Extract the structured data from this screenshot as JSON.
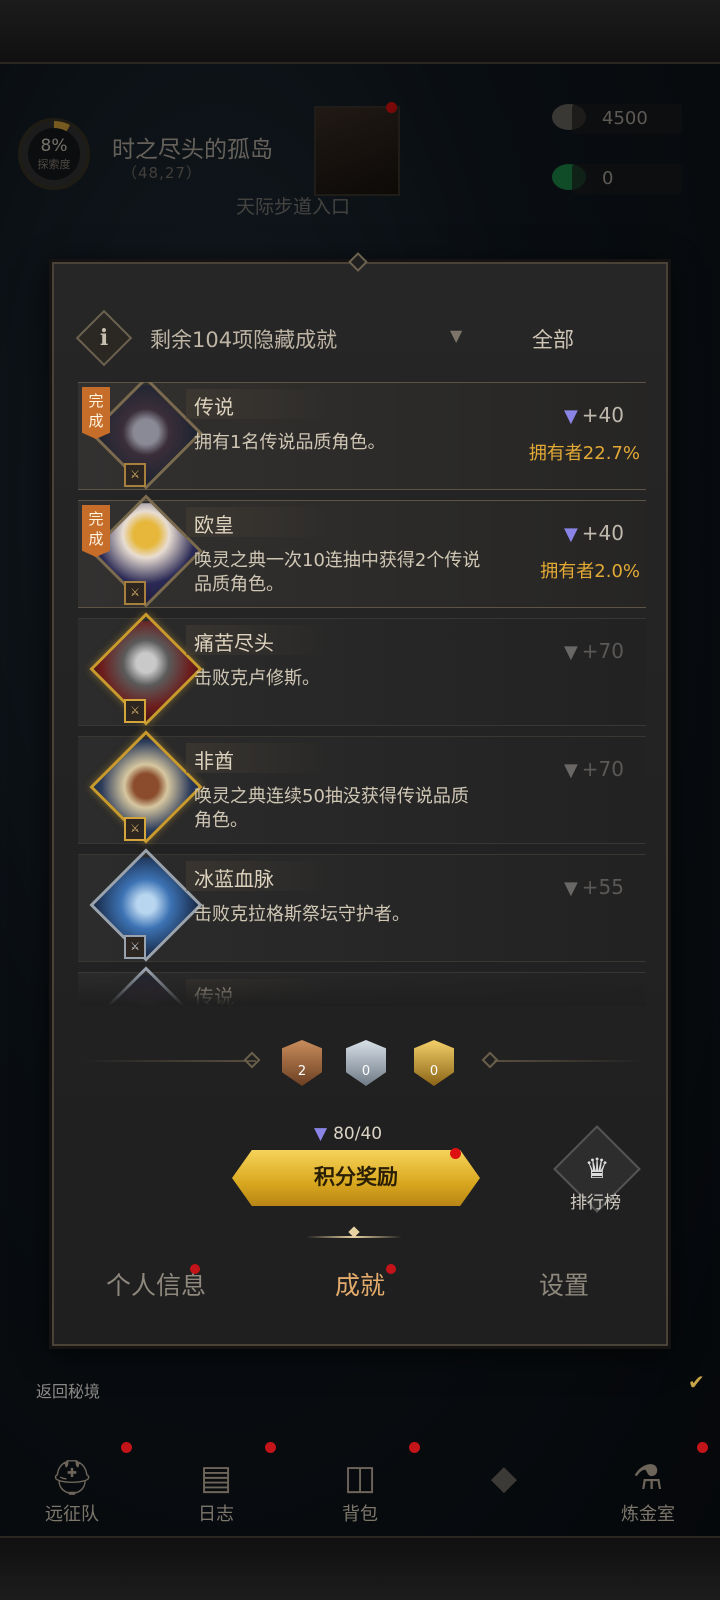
{
  "map": {
    "explore_percent": "8%",
    "explore_label": "探索度",
    "title": "时之尽头的孤岛",
    "coords": "（48,27）",
    "subtitle": "天际步道入口"
  },
  "resources": [
    {
      "icon": "ore-icon",
      "value": "4500"
    },
    {
      "icon": "emerald-icon",
      "value": "0"
    }
  ],
  "filter": {
    "text": "剩余104项隐藏成就",
    "scope": "全部"
  },
  "achievements": [
    {
      "done_tag": "完成",
      "title": "传说",
      "desc": "拥有1名传说品质角色。",
      "points": "+40",
      "owners": "拥有者22.7%",
      "state": "done",
      "frame": "bronze",
      "icon": "knight-portrait-icon"
    },
    {
      "done_tag": "完成",
      "title": "欧皇",
      "desc": "唤灵之典一次10连抽中获得2个传说品质角色。",
      "points": "+40",
      "owners": "拥有者2.0%",
      "state": "done",
      "frame": "bronze",
      "icon": "crowned-king-icon"
    },
    {
      "done_tag": "",
      "title": "痛苦尽头",
      "desc": "击败克卢修斯。",
      "points": "+70",
      "owners": "",
      "state": "locked",
      "frame": "gold",
      "icon": "dark-knight-icon"
    },
    {
      "done_tag": "",
      "title": "非酋",
      "desc": "唤灵之典连续50抽没获得传说品质角色。",
      "points": "+70",
      "owners": "",
      "state": "locked",
      "frame": "gold",
      "icon": "tribal-warrior-icon"
    },
    {
      "done_tag": "",
      "title": "冰蓝血脉",
      "desc": "击败克拉格斯祭坛守护者。",
      "points": "+55",
      "owners": "",
      "state": "locked",
      "frame": "silver",
      "icon": "ice-dragon-icon"
    },
    {
      "done_tag": "",
      "title": "传说",
      "desc": "",
      "points": "",
      "owners": "",
      "state": "locked",
      "frame": "silver",
      "icon": "knight-portrait-icon"
    }
  ],
  "medals": {
    "bronze": "2",
    "silver": "0",
    "gold": "0"
  },
  "score": "80/40",
  "reward_button": "积分奖励",
  "ranking_label": "排行榜",
  "tabs": [
    "个人信息",
    "成就",
    "设置"
  ],
  "return_label": "返回秘境",
  "game_nav": [
    {
      "label": "远征队",
      "icon": "helmet-icon",
      "dot": true
    },
    {
      "label": "日志",
      "icon": "journal-icon",
      "dot": true
    },
    {
      "label": "背包",
      "icon": "backpack-icon",
      "dot": true
    },
    {
      "label": "",
      "icon": "locked-icon",
      "dot": false
    },
    {
      "label": "炼金室",
      "icon": "alchemy-icon",
      "dot": true
    }
  ]
}
